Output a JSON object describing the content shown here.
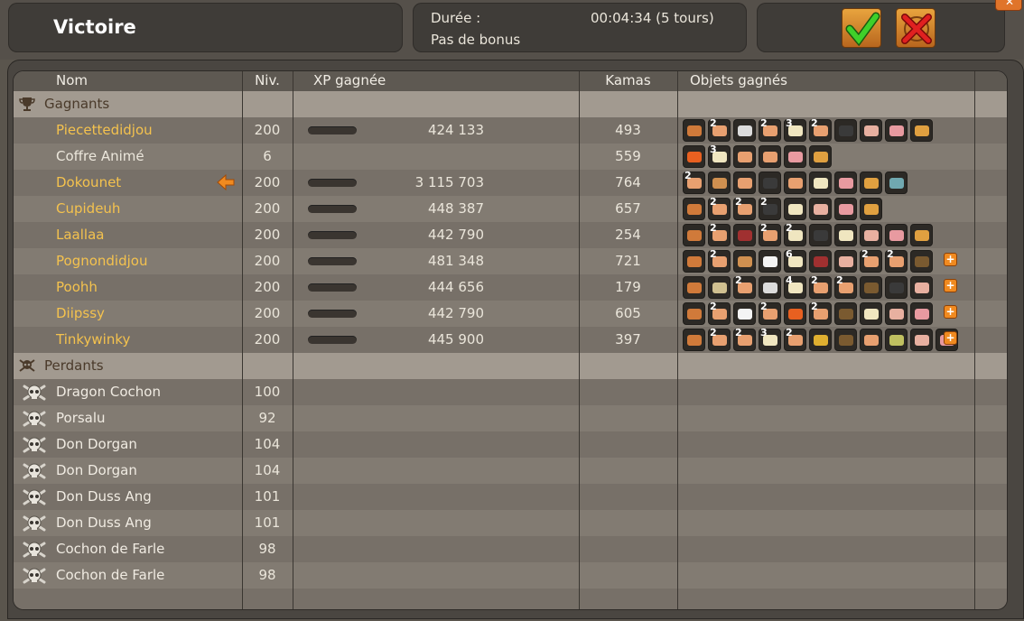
{
  "header": {
    "title": "Victoire",
    "duration_label": "Durée :",
    "duration_value": "00:04:34 (5 tours)",
    "bonus": "Pas de bonus"
  },
  "columns": {
    "name": "Nom",
    "level": "Niv.",
    "xp": "XP gagnée",
    "kamas": "Kamas",
    "items": "Objets gagnés"
  },
  "sections": {
    "winners": "Gagnants",
    "losers": "Perdants"
  },
  "winners": [
    {
      "name": "Piecettedidjou",
      "level": "200",
      "xp": "424 133",
      "kamas": "493",
      "items": [
        {
          "c": "#d07a3a"
        },
        {
          "c": "#e8a070",
          "q": "2"
        },
        {
          "c": "#dcdcdc"
        },
        {
          "c": "#e8a070",
          "q": "2"
        },
        {
          "c": "#f0e6c0",
          "q": "3"
        },
        {
          "c": "#e8a070",
          "q": "2"
        },
        {
          "c": "#3a3a3a"
        },
        {
          "c": "#e8b0a0"
        },
        {
          "c": "#e89aa0"
        },
        {
          "c": "#e0a040"
        }
      ]
    },
    {
      "name": "Coffre Animé",
      "level": "6",
      "xp": "",
      "kamas": "559",
      "neutral": true,
      "items": [
        {
          "c": "#e86020"
        },
        {
          "c": "#f0e6c0",
          "q": "3"
        },
        {
          "c": "#e8a070"
        },
        {
          "c": "#e8a070"
        },
        {
          "c": "#e89aa0"
        },
        {
          "c": "#e0a040"
        }
      ]
    },
    {
      "name": "Dokounet",
      "level": "200",
      "xp": "3 115 703",
      "kamas": "764",
      "arrow": true,
      "items": [
        {
          "c": "#e8a070",
          "q": "2"
        },
        {
          "c": "#d09050"
        },
        {
          "c": "#e8a070"
        },
        {
          "c": "#3a3a3a"
        },
        {
          "c": "#e8a070"
        },
        {
          "c": "#f0e6c0"
        },
        {
          "c": "#e89aa0"
        },
        {
          "c": "#e0a040"
        },
        {
          "c": "#70a8b0"
        }
      ]
    },
    {
      "name": "Cupideuh",
      "level": "200",
      "xp": "448 387",
      "kamas": "657",
      "items": [
        {
          "c": "#d07a3a"
        },
        {
          "c": "#e8a070",
          "q": "2"
        },
        {
          "c": "#e8a070",
          "q": "2"
        },
        {
          "c": "#3a3a3a",
          "q": "2"
        },
        {
          "c": "#f0e6c0"
        },
        {
          "c": "#e8b0a0"
        },
        {
          "c": "#e89aa0"
        },
        {
          "c": "#e0a040"
        }
      ]
    },
    {
      "name": "Laallaa",
      "level": "200",
      "xp": "442 790",
      "kamas": "254",
      "items": [
        {
          "c": "#d07a3a"
        },
        {
          "c": "#e8a070",
          "q": "2"
        },
        {
          "c": "#a03030"
        },
        {
          "c": "#e8a070",
          "q": "2"
        },
        {
          "c": "#f0e6c0",
          "q": "2"
        },
        {
          "c": "#3a3a3a"
        },
        {
          "c": "#f0e6c0"
        },
        {
          "c": "#e8b0a0"
        },
        {
          "c": "#e89aa0"
        },
        {
          "c": "#e0a040"
        }
      ]
    },
    {
      "name": "Pognondidjou",
      "level": "200",
      "xp": "481 348",
      "kamas": "721",
      "plus": true,
      "items": [
        {
          "c": "#d07a3a"
        },
        {
          "c": "#e8a070",
          "q": "2"
        },
        {
          "c": "#d09050"
        },
        {
          "c": "#f4f4f4"
        },
        {
          "c": "#f0e6c0",
          "q": "6"
        },
        {
          "c": "#a03030"
        },
        {
          "c": "#e8b0a0"
        },
        {
          "c": "#e8a070",
          "q": "2"
        },
        {
          "c": "#e8a070",
          "q": "2"
        },
        {
          "c": "#7a5a30"
        }
      ]
    },
    {
      "name": "Poohh",
      "level": "200",
      "xp": "444 656",
      "kamas": "179",
      "plus": true,
      "items": [
        {
          "c": "#d07a3a"
        },
        {
          "c": "#d0c090"
        },
        {
          "c": "#e8a070",
          "q": "2"
        },
        {
          "c": "#dcdcdc"
        },
        {
          "c": "#f0e6c0",
          "q": "4"
        },
        {
          "c": "#e8a070",
          "q": "2"
        },
        {
          "c": "#e8a070",
          "q": "2"
        },
        {
          "c": "#7a5a30"
        },
        {
          "c": "#3a3a3a"
        },
        {
          "c": "#e8b0a0"
        }
      ]
    },
    {
      "name": "Diipssy",
      "level": "200",
      "xp": "442 790",
      "kamas": "605",
      "plus": true,
      "items": [
        {
          "c": "#d07a3a"
        },
        {
          "c": "#e8a070",
          "q": "2"
        },
        {
          "c": "#f4f4f4"
        },
        {
          "c": "#e8a070",
          "q": "2"
        },
        {
          "c": "#e86020"
        },
        {
          "c": "#e8a070",
          "q": "2"
        },
        {
          "c": "#7a5a30"
        },
        {
          "c": "#f0e6c0"
        },
        {
          "c": "#e8b0a0"
        },
        {
          "c": "#e89aa0"
        }
      ]
    },
    {
      "name": "Tinkywinky",
      "level": "200",
      "xp": "445 900",
      "kamas": "397",
      "plus": true,
      "items": [
        {
          "c": "#d07a3a"
        },
        {
          "c": "#e8a070",
          "q": "2"
        },
        {
          "c": "#e8a070",
          "q": "2"
        },
        {
          "c": "#f0e6c0",
          "q": "3"
        },
        {
          "c": "#e8a070",
          "q": "2"
        },
        {
          "c": "#e0b030"
        },
        {
          "c": "#7a5a30"
        },
        {
          "c": "#e8a070"
        },
        {
          "c": "#c0c060"
        },
        {
          "c": "#e8b0a0"
        },
        {
          "c": "#e89aa0"
        }
      ]
    }
  ],
  "losers": [
    {
      "name": "Dragon Cochon",
      "level": "100"
    },
    {
      "name": "Porsalu",
      "level": "92"
    },
    {
      "name": "Don Dorgan",
      "level": "104"
    },
    {
      "name": "Don Dorgan",
      "level": "104"
    },
    {
      "name": "Don Duss Ang",
      "level": "101"
    },
    {
      "name": "Don Duss Ang",
      "level": "101"
    },
    {
      "name": "Cochon de Farle",
      "level": "98"
    },
    {
      "name": "Cochon de Farle",
      "level": "98"
    }
  ],
  "icons": {
    "ok": "checkmark-icon",
    "cancel": "cancel-cross-icon",
    "close": "close-icon",
    "trophy": "trophy-icon",
    "skull": "skull-icon",
    "arrow": "arrow-left-icon",
    "plus": "plus-icon"
  },
  "colors": {
    "winner_name": "#f4c24e",
    "accent_orange": "#f08a20"
  }
}
